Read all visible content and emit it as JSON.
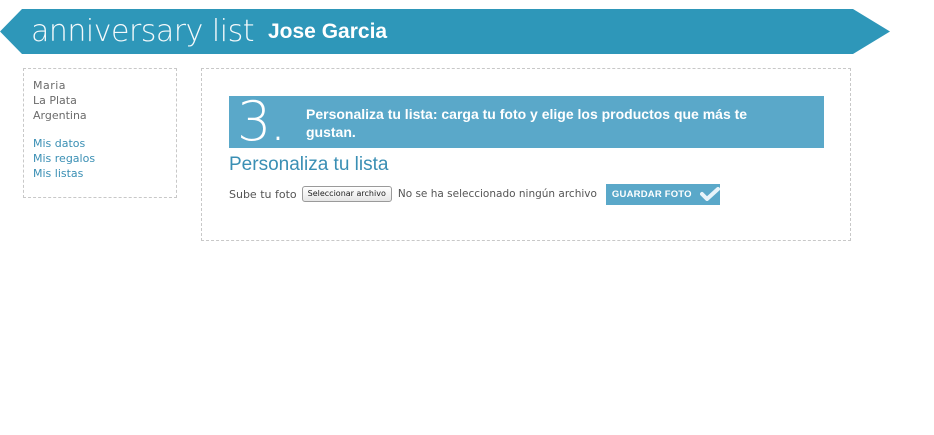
{
  "header": {
    "brand": "anniversary list",
    "user_name": "Jose Garcia",
    "banner_color": "#2e97b9"
  },
  "sidebar": {
    "name": "Maria",
    "city": "La Plata",
    "country": "Argentina",
    "links": [
      "Mis datos",
      "Mis regalos",
      "Mis listas"
    ],
    "link_color": "#3a8fb4"
  },
  "main": {
    "step": {
      "number": "3.",
      "text": "Personaliza tu lista: carga tu foto y elige los productos que más te gustan.",
      "color": "#5aa8c9"
    },
    "section_title": "Personaliza tu lista",
    "upload": {
      "label": "Sube tu foto",
      "file_button": "Seleccionar archivo",
      "file_status": "No se ha seleccionado ningún archivo",
      "save_button": "GUARDAR FOTO",
      "save_icon": "check-icon"
    }
  }
}
